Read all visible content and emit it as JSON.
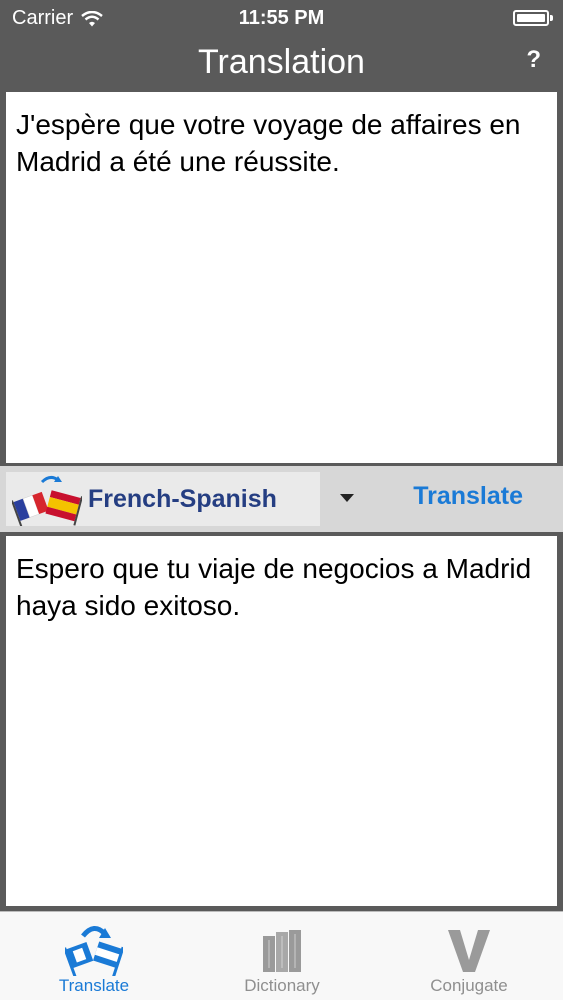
{
  "status_bar": {
    "carrier": "Carrier",
    "time": "11:55 PM",
    "battery_level": 1.0
  },
  "nav": {
    "title": "Translation",
    "help_label": "?"
  },
  "source": {
    "text": "J'espère que votre voyage de affaires en Madrid a été une réussite."
  },
  "language_bar": {
    "pair_label": "French-Spanish",
    "translate_label": "Translate"
  },
  "target": {
    "text": "Espero que tu viaje de negocios a Madrid haya sido exitoso."
  },
  "tabs": [
    {
      "label": "Translate",
      "icon": "translate-flags-icon",
      "active": true
    },
    {
      "label": "Dictionary",
      "icon": "books-icon",
      "active": false
    },
    {
      "label": "Conjugate",
      "icon": "v-letter-icon",
      "active": false
    }
  ],
  "colors": {
    "chrome": "#5a5a5a",
    "accent": "#1a7ad6",
    "language_label": "#253e82",
    "tab_inactive": "#8f8f8f"
  }
}
